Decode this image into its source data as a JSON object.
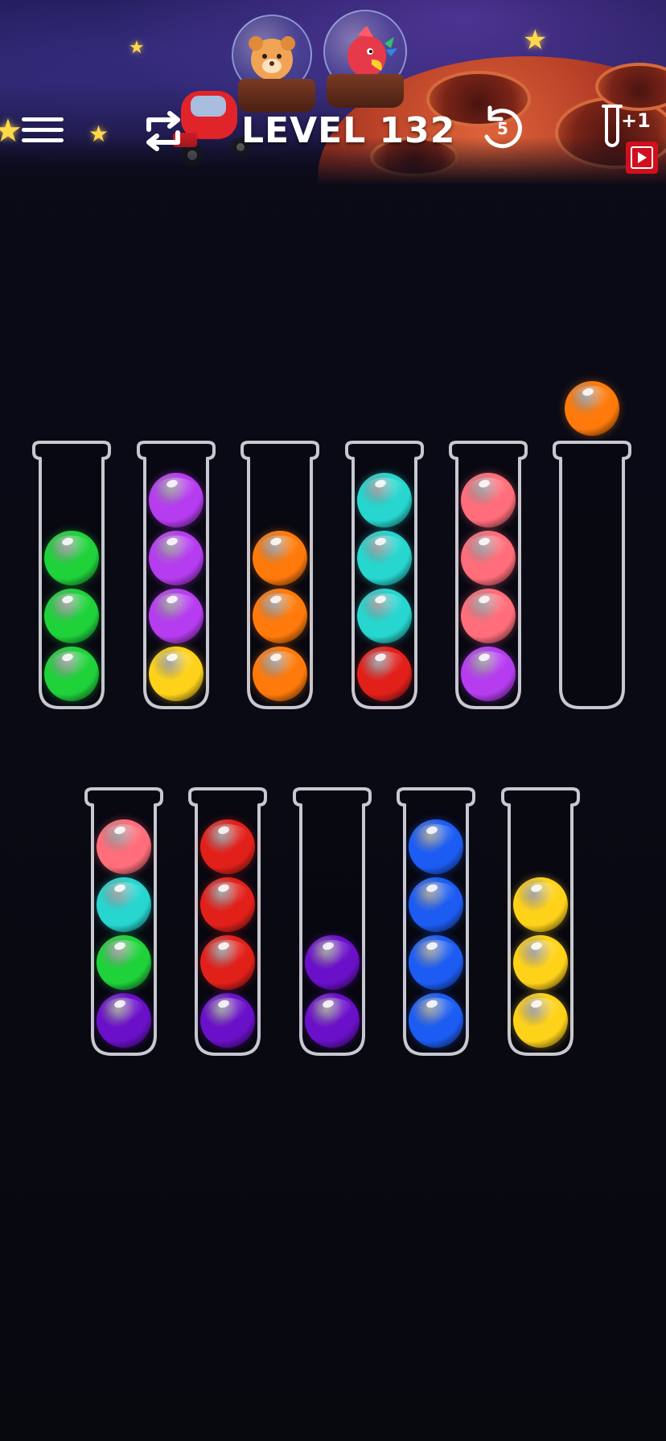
{
  "header": {
    "level_title": "LEVEL 132",
    "undo_count": "5",
    "add_tube_label": "+1",
    "icons": {
      "menu": "hamburger-menu-icon",
      "restart": "restart-arrows-icon",
      "undo": "undo-icon",
      "add_tube": "add-tube-icon",
      "video": "video-ad-icon"
    }
  },
  "colors": {
    "background": "#0a0a14",
    "tube_outline": "#c8c8d0",
    "green": "#1fd23a",
    "purple": "#b63cf0",
    "yellow": "#ffd21a",
    "orange": "#ff7a0a",
    "cyan": "#26d6cf",
    "red": "#e2201a",
    "pink": "#ff6e7a",
    "indigo": "#6a10c8",
    "blue": "#1c5cf2"
  },
  "board": {
    "lifted_ball": "orange",
    "rows": [
      {
        "tubes": [
          {
            "balls_top_to_bottom": [
              "green",
              "green",
              "green"
            ]
          },
          {
            "balls_top_to_bottom": [
              "purple",
              "purple",
              "purple",
              "yellow"
            ]
          },
          {
            "balls_top_to_bottom": [
              "orange",
              "orange",
              "orange"
            ]
          },
          {
            "balls_top_to_bottom": [
              "cyan",
              "cyan",
              "cyan",
              "red"
            ]
          },
          {
            "balls_top_to_bottom": [
              "pink",
              "pink",
              "pink",
              "purple"
            ]
          },
          {
            "balls_top_to_bottom": []
          }
        ]
      },
      {
        "tubes": [
          {
            "balls_top_to_bottom": [
              "pink",
              "cyan",
              "green",
              "indigo"
            ]
          },
          {
            "balls_top_to_bottom": [
              "red",
              "red",
              "red",
              "indigo"
            ]
          },
          {
            "balls_top_to_bottom": [
              "indigo",
              "indigo"
            ]
          },
          {
            "balls_top_to_bottom": [
              "blue",
              "blue",
              "blue",
              "blue"
            ]
          },
          {
            "balls_top_to_bottom": [
              "yellow",
              "yellow",
              "yellow"
            ]
          }
        ]
      }
    ]
  }
}
